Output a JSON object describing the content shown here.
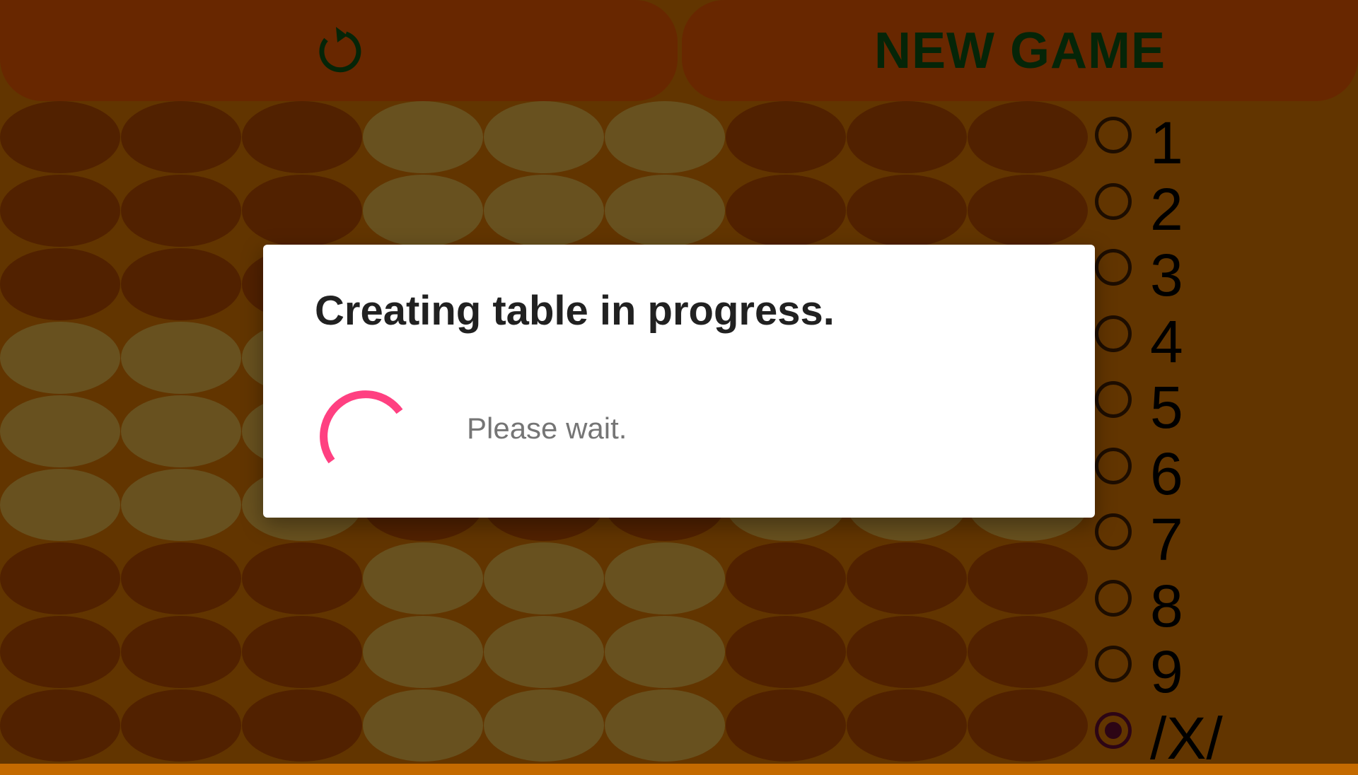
{
  "toolbar": {
    "undo_icon": "undo-icon",
    "new_game_label": "NEW GAME",
    "button_color": "#d14e00",
    "text_color": "#0b4a11"
  },
  "board": {
    "rows": 9,
    "cols": 9,
    "dark_color": "#a34300",
    "light_color": "#d0a23f"
  },
  "options": [
    {
      "label": "1",
      "selected": false
    },
    {
      "label": "2",
      "selected": false
    },
    {
      "label": "3",
      "selected": false
    },
    {
      "label": "4",
      "selected": false
    },
    {
      "label": "5",
      "selected": false
    },
    {
      "label": "6",
      "selected": false
    },
    {
      "label": "7",
      "selected": false
    },
    {
      "label": "8",
      "selected": false
    },
    {
      "label": "9",
      "selected": false
    },
    {
      "label": "/X/",
      "selected": true
    }
  ],
  "dialog": {
    "title": "Creating table in progress.",
    "message": "Please wait.",
    "spinner_color": "#ff4081"
  }
}
